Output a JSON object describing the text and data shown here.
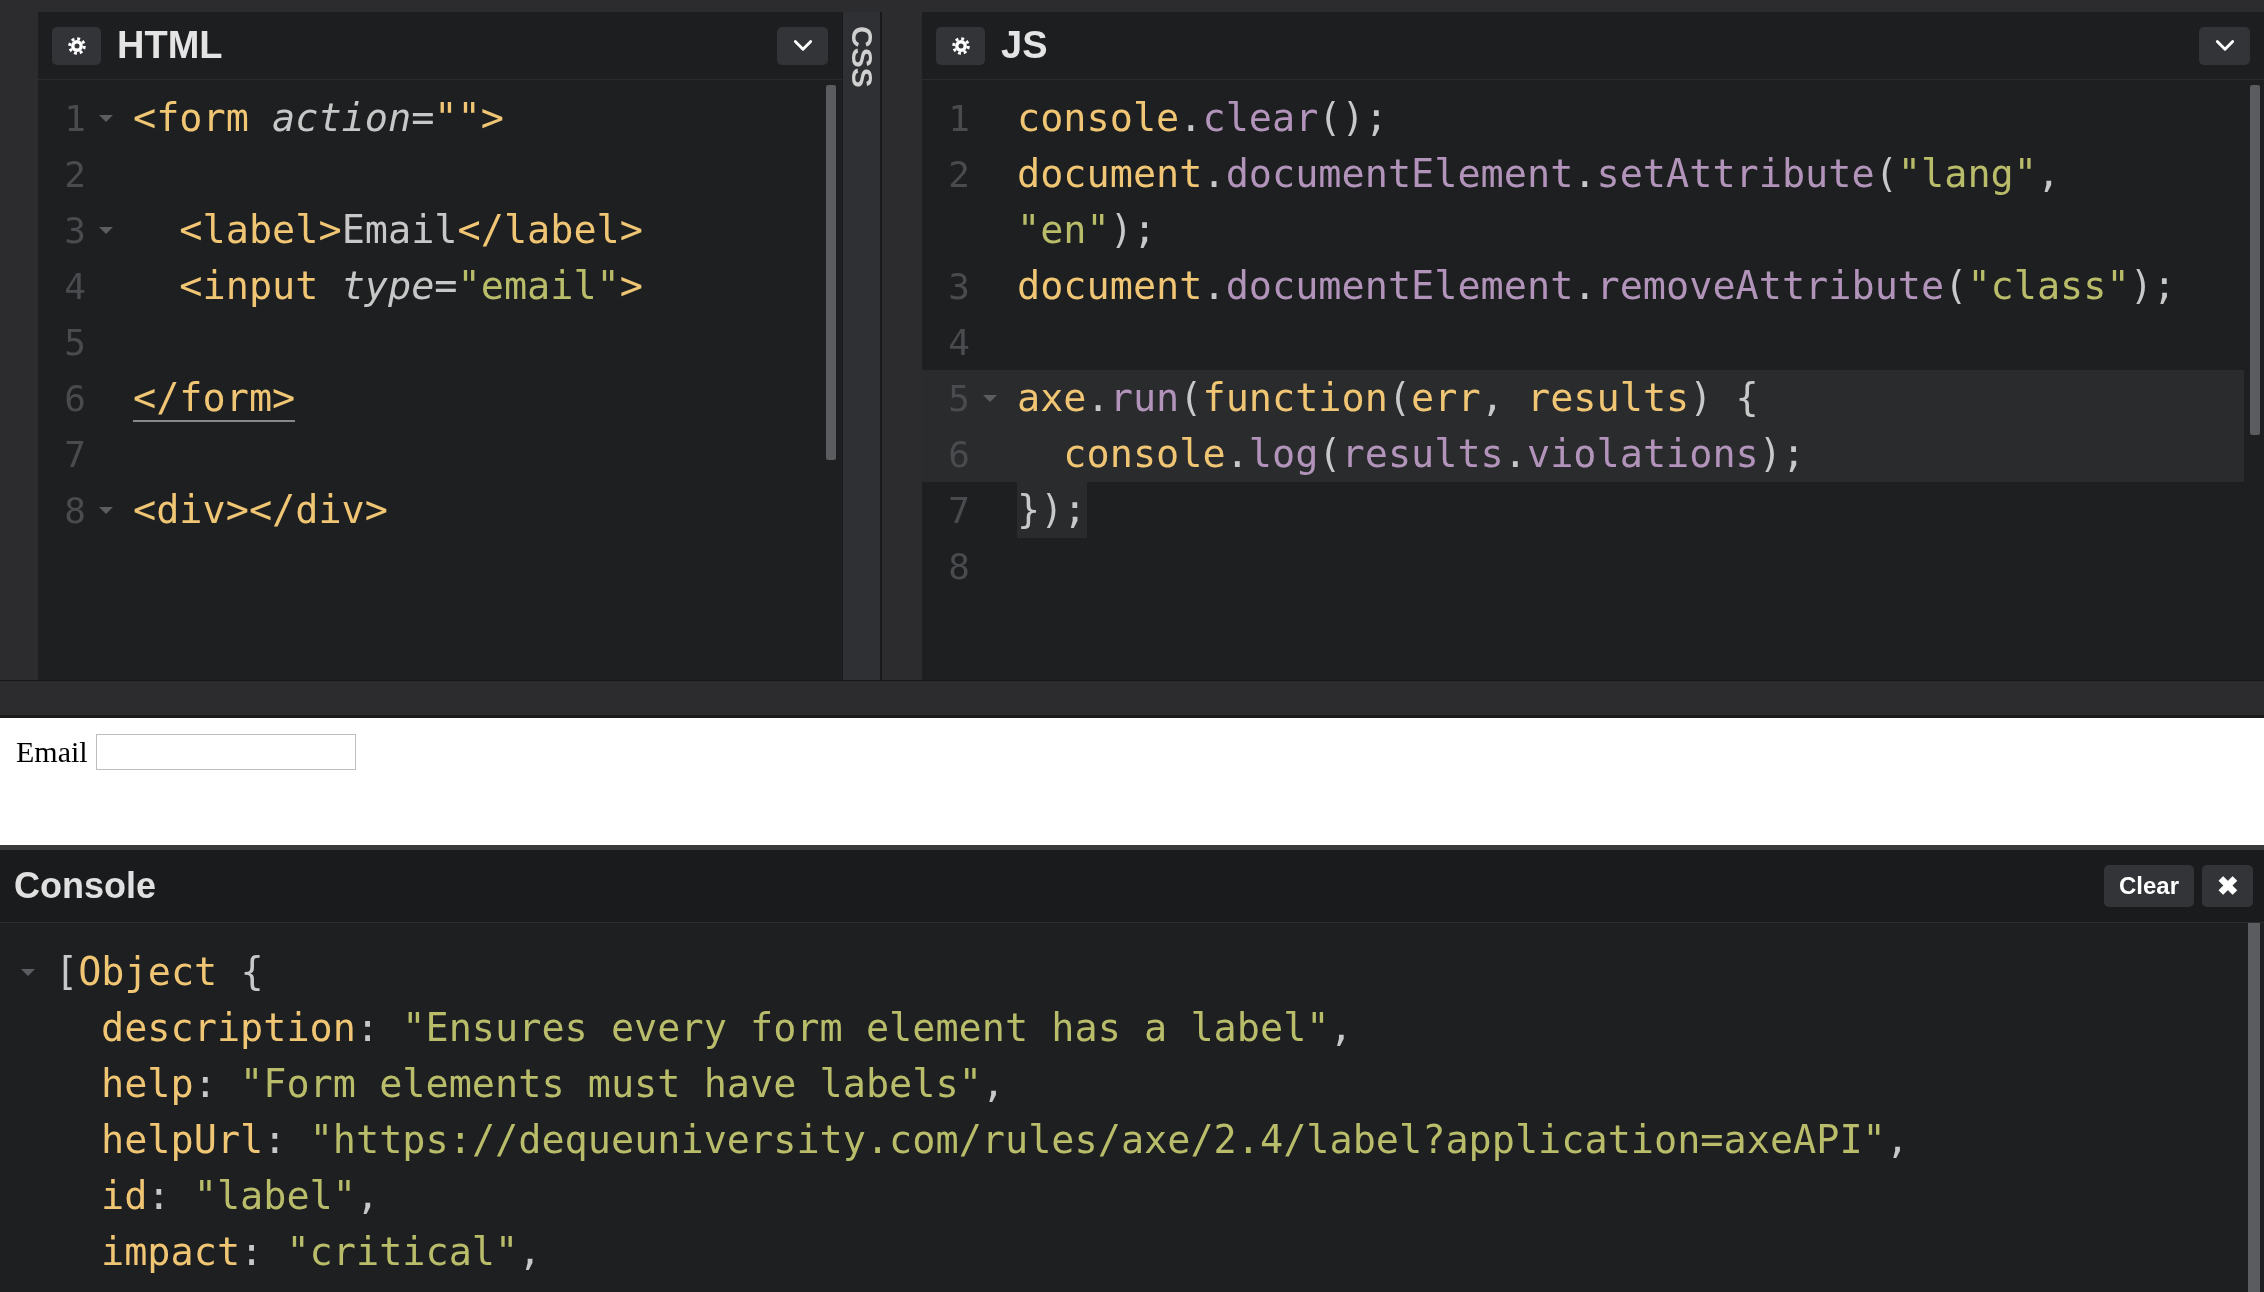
{
  "panels": [
    {
      "kind": "editor",
      "title": "HTML",
      "lines": [
        {
          "number": "1",
          "fold": true,
          "tokens": [
            {
              "kind": "tag",
              "text": "<form "
            },
            {
              "kind": "attr",
              "text": "action"
            },
            {
              "kind": "punct",
              "text": "="
            },
            {
              "kind": "tag",
              "text": "\"\">"
            }
          ]
        },
        {
          "number": "2",
          "fold": false
        },
        {
          "number": "3",
          "fold": true,
          "tokens": [
            {
              "kind": "tag",
              "text": "  <label>"
            },
            {
              "kind": "plain",
              "text": "Email"
            },
            {
              "kind": "tag",
              "text": "</label>"
            }
          ]
        },
        {
          "number": "4",
          "fold": false,
          "tokens": [
            {
              "kind": "tag",
              "text": "  <input "
            },
            {
              "kind": "attr",
              "text": "type"
            },
            {
              "kind": "punct",
              "text": "="
            },
            {
              "kind": "string",
              "text": "\"email\""
            },
            {
              "kind": "tag",
              "text": ">"
            }
          ]
        },
        {
          "number": "5",
          "fold": false
        },
        {
          "number": "6",
          "fold": false,
          "tokens": [
            {
              "kind": "tag",
              "text": "</form>",
              "matched": true
            }
          ]
        },
        {
          "number": "7",
          "fold": false
        },
        {
          "number": "8",
          "fold": true,
          "tokens": [
            {
              "kind": "tag",
              "text": "<div></div>"
            }
          ]
        }
      ]
    },
    {
      "kind": "collapsed",
      "title": "CSS"
    },
    {
      "kind": "editor",
      "title": "JS",
      "lines": [
        {
          "number": "1",
          "fold": false,
          "tokens": [
            {
              "kind": "keyword",
              "text": "console"
            },
            {
              "kind": "member",
              "text": ".clear"
            },
            {
              "kind": "punct",
              "text": "();"
            }
          ]
        },
        {
          "number": "2",
          "fold": false,
          "tokens": [
            {
              "kind": "keyword",
              "text": "document"
            },
            {
              "kind": "punct",
              "text": "."
            },
            {
              "kind": "prop",
              "text": "documentElement"
            },
            {
              "kind": "punct",
              "text": "."
            },
            {
              "kind": "prop",
              "text": "setAttribute"
            },
            {
              "kind": "punct",
              "text": "("
            },
            {
              "kind": "string",
              "text": "\"lang\""
            },
            {
              "kind": "punct",
              "text": ","
            }
          ],
          "continued": [
            {
              "kind": "string",
              "text": "\"en\""
            },
            {
              "kind": "punct",
              "text": ");"
            }
          ]
        },
        {
          "number": "3",
          "fold": false,
          "tokens": [
            {
              "kind": "keyword",
              "text": "document"
            },
            {
              "kind": "punct",
              "text": "."
            },
            {
              "kind": "prop",
              "text": "documentElement"
            },
            {
              "kind": "punct",
              "text": "."
            },
            {
              "kind": "prop",
              "text": "removeAttribute"
            },
            {
              "kind": "punct",
              "text": "("
            },
            {
              "kind": "string",
              "text": "\"class\""
            },
            {
              "kind": "punct",
              "text": ");"
            }
          ]
        },
        {
          "number": "4",
          "fold": false
        },
        {
          "number": "5",
          "fold": true,
          "active": true,
          "tokens": [
            {
              "kind": "keyword",
              "text": "axe"
            },
            {
              "kind": "punct",
              "text": "."
            },
            {
              "kind": "prop",
              "text": "run"
            },
            {
              "kind": "punct",
              "text": "("
            },
            {
              "kind": "keyword",
              "text": "function"
            },
            {
              "kind": "punct",
              "text": "("
            },
            {
              "kind": "keyword",
              "text": "err"
            },
            {
              "kind": "punct",
              "text": ", "
            },
            {
              "kind": "keyword",
              "text": "results"
            },
            {
              "kind": "punct",
              "text": ") {"
            }
          ]
        },
        {
          "number": "6",
          "fold": false,
          "active": true,
          "tokens": [
            {
              "kind": "keyword",
              "text": "  console"
            },
            {
              "kind": "punct",
              "text": "."
            },
            {
              "kind": "prop",
              "text": "log"
            },
            {
              "kind": "punct",
              "text": "("
            },
            {
              "kind": "prop",
              "text": "results"
            },
            {
              "kind": "punct",
              "text": "."
            },
            {
              "kind": "prop",
              "text": "violations"
            },
            {
              "kind": "punct",
              "text": ");"
            }
          ]
        },
        {
          "number": "7",
          "fold": false,
          "text_selected": true,
          "tokens": [
            {
              "kind": "punct",
              "text": "});"
            }
          ]
        },
        {
          "number": "8",
          "fold": false
        }
      ]
    }
  ],
  "preview": {
    "label": "Email"
  },
  "console": {
    "title": "Console",
    "buttons": [
      {
        "kind": "text",
        "label": "Clear"
      },
      {
        "kind": "close",
        "label": "✖"
      }
    ],
    "rows": [
      {
        "expanded": true,
        "tokens": [
          {
            "kind": "punct",
            "text": "["
          },
          {
            "kind": "keyword",
            "text": "Object"
          },
          {
            "kind": "punct",
            "text": " {"
          }
        ],
        "children": [
          {
            "tokens": [
              {
                "kind": "keyword",
                "text": "description"
              },
              {
                "kind": "punct",
                "text": ": "
              },
              {
                "kind": "string",
                "text": "\"Ensures every form element has a label\""
              },
              {
                "kind": "punct",
                "text": ","
              }
            ]
          },
          {
            "tokens": [
              {
                "kind": "keyword",
                "text": "help"
              },
              {
                "kind": "punct",
                "text": ": "
              },
              {
                "kind": "string",
                "text": "\"Form elements must have labels\""
              },
              {
                "kind": "punct",
                "text": ","
              }
            ]
          },
          {
            "tokens": [
              {
                "kind": "keyword",
                "text": "helpUrl"
              },
              {
                "kind": "punct",
                "text": ": "
              },
              {
                "kind": "string",
                "text": "\"https://dequeuniversity.com/rules/axe/2.4/label?application=axeAPI\""
              },
              {
                "kind": "punct",
                "text": ","
              }
            ]
          },
          {
            "tokens": [
              {
                "kind": "keyword",
                "text": "id"
              },
              {
                "kind": "punct",
                "text": ": "
              },
              {
                "kind": "string",
                "text": "\"label\""
              },
              {
                "kind": "punct",
                "text": ","
              }
            ]
          },
          {
            "tokens": [
              {
                "kind": "keyword",
                "text": "impact"
              },
              {
                "kind": "punct",
                "text": ": "
              },
              {
                "kind": "string",
                "text": "\"critical\""
              },
              {
                "kind": "punct",
                "text": ","
              }
            ]
          }
        ]
      }
    ]
  }
}
